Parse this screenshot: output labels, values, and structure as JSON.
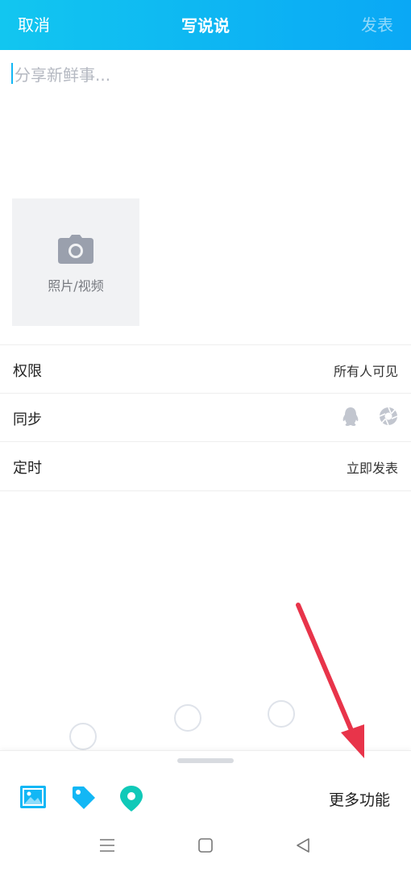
{
  "header": {
    "cancel_label": "取消",
    "title": "写说说",
    "publish_label": "发表",
    "gradient_start": "#12c6f0",
    "gradient_end": "#0aa8f5"
  },
  "compose": {
    "placeholder": "分享新鲜事..."
  },
  "media": {
    "icon": "camera-icon",
    "label": "照片/视频"
  },
  "settings": [
    {
      "label": "权限",
      "value": "所有人可见"
    },
    {
      "label": "同步",
      "icons": [
        "qq-penguin-icon",
        "camera-shutter-icon"
      ]
    },
    {
      "label": "定时",
      "value": "立即发表"
    }
  ],
  "toolbar": {
    "icons": [
      "image-icon",
      "tag-icon",
      "location-pin-icon"
    ],
    "more_label": "更多功能",
    "accent": "#12b7f5"
  },
  "annotation": {
    "arrow_color": "#e8344a",
    "arrow_icon": "red-arrow-icon"
  },
  "navbar": {
    "icons": [
      "menu-icon",
      "home-square-icon",
      "back-triangle-icon"
    ]
  }
}
